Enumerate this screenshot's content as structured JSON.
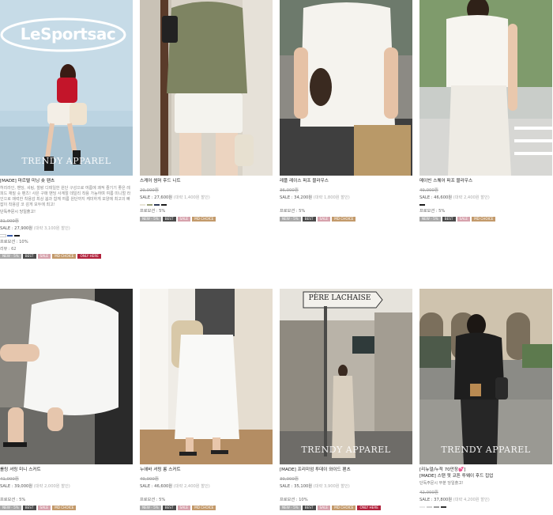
{
  "watermark": "TRENDY APPAREL",
  "badge_colors": {
    "new": "#a9a9a9",
    "best": "#4b4b4b",
    "sale": "#d7a3ad",
    "md": "#c39a6b",
    "only": "#b1223c"
  },
  "products": [
    {
      "name": "[MADE] 마르텔 미닝 숏 팬츠",
      "image_sign": "LeSportsac",
      "description": "허리라인, 밴딩, 셔링, 찰랑 디테일한 원단 구성으로 여름에 쾌적 즐기기 좋은 레피드 재질 숏 팬츠! 사은 구매 밴딩 사계절 데일리 착용 가능하며 여름 미니멀 라인으로 매력한 착용감 최상 봄과 함께 여름 원단까지 케미하게 모양에 최고의 빠잡이 착용감 코 감게 모두에 최고!",
      "note": "단독주문시 당일출고!",
      "original_price": "31,000원",
      "sale_price": "SALE : 27,900원",
      "discount": "(대략 3,100원 할인)",
      "swatches": [
        "#ffffff",
        "#3a5ca8",
        "#1d1d1d"
      ],
      "promotion": "프로모션 : 10%",
      "reviews": "리뷰 : 62",
      "badges": [
        {
          "label": "NEW - 5%",
          "type": "new"
        },
        {
          "label": "BEST",
          "type": "best"
        },
        {
          "label": "SALE",
          "type": "sale"
        },
        {
          "label": "MD CHOICE",
          "type": "md"
        },
        {
          "label": "ONLY HERE",
          "type": "only"
        }
      ]
    },
    {
      "name": "스케어 썸머 후드 니트",
      "original_price": "29,000원",
      "sale_price": "SALE : 27,600원",
      "discount": "(대략 1,400원 할인)",
      "swatches": [
        "#e8e4d6",
        "#9aa07a",
        "#2f3b58",
        "#1d1d1d"
      ],
      "promotion": "프로모션 : 5%",
      "badges": [
        {
          "label": "NEW - 5%",
          "type": "new"
        },
        {
          "label": "BEST",
          "type": "best"
        },
        {
          "label": "SALE",
          "type": "sale"
        },
        {
          "label": "MD CHOICE",
          "type": "md"
        }
      ]
    },
    {
      "name": "레플 레이스 퍼프 블라우스",
      "original_price": "36,000원",
      "sale_price": "SALE : 34,200원",
      "discount": "(대략 1,800원 할인)",
      "swatches": [],
      "promotion": "프로모션 : 5%",
      "badges": [
        {
          "label": "NEW - 5%",
          "type": "new"
        },
        {
          "label": "BEST",
          "type": "best"
        },
        {
          "label": "SALE",
          "type": "sale"
        },
        {
          "label": "MD CHOICE",
          "type": "md"
        }
      ]
    },
    {
      "name": "메이빈 스퀘어 퍼프 블라우스",
      "original_price": "49,000원",
      "sale_price": "SALE : 46,600원",
      "discount": "(대략 2,400원 할인)",
      "swatches": [
        "#1d1d1d"
      ],
      "promotion": "프로모션 : 5%",
      "badges": [
        {
          "label": "NEW - 5%",
          "type": "new"
        },
        {
          "label": "BEST",
          "type": "best"
        },
        {
          "label": "SALE",
          "type": "sale"
        },
        {
          "label": "MD CHOICE",
          "type": "md"
        }
      ]
    },
    {
      "name": "롤링 셔링 미니 스커트",
      "original_price": "41,000원",
      "sale_price": "SALE : 39,000원",
      "discount": "(대략 2,000원 할인)",
      "swatches": [],
      "promotion": "프로모션 : 5%",
      "badges": [
        {
          "label": "NEW - 5%",
          "type": "new"
        },
        {
          "label": "BEST",
          "type": "best"
        },
        {
          "label": "SALE",
          "type": "sale"
        },
        {
          "label": "MD CHOICE",
          "type": "md"
        }
      ]
    },
    {
      "name": "누에바 셔링 롱 스커트",
      "original_price": "49,000원",
      "sale_price": "SALE : 46,600원",
      "discount": "(대략 2,400원 할인)",
      "swatches": [],
      "promotion": "프로모션 : 5%",
      "badges": [
        {
          "label": "NEW - 5%",
          "type": "new"
        },
        {
          "label": "BEST",
          "type": "best"
        },
        {
          "label": "SALE",
          "type": "sale"
        },
        {
          "label": "MD CHOICE",
          "type": "md"
        }
      ]
    },
    {
      "name": "[MADE] 프리미엄 투데이 와이드 팬츠",
      "image_sign": "PÈRE LACHAISE",
      "original_price": "39,000원",
      "sale_price": "SALE : 35,100원",
      "discount": "(대략 3,900원 할인)",
      "swatches": [],
      "promotion": "프로모션 : 10%",
      "badges": [
        {
          "label": "NEW - 5%",
          "type": "new"
        },
        {
          "label": "BEST",
          "type": "best"
        },
        {
          "label": "SALE",
          "type": "sale"
        },
        {
          "label": "MD CHOICE",
          "type": "md"
        },
        {
          "label": "ONLY HERE",
          "type": "only"
        }
      ]
    },
    {
      "name": "[리뉴얼/누적 70만장💕]",
      "name2": "[MADE] 스탠 핏 코튼 투웨이 후드 집업",
      "note": "단독주문시 부분 당일출고!",
      "original_price": "42,000원",
      "sale_price": "SALE : 37,800원",
      "discount": "(대략 4,200원 할인)",
      "swatches": [
        "#e8e8e8",
        "#cfcfcf",
        "#9a9a9a",
        "#333333"
      ],
      "promotion": "",
      "badges": []
    }
  ]
}
